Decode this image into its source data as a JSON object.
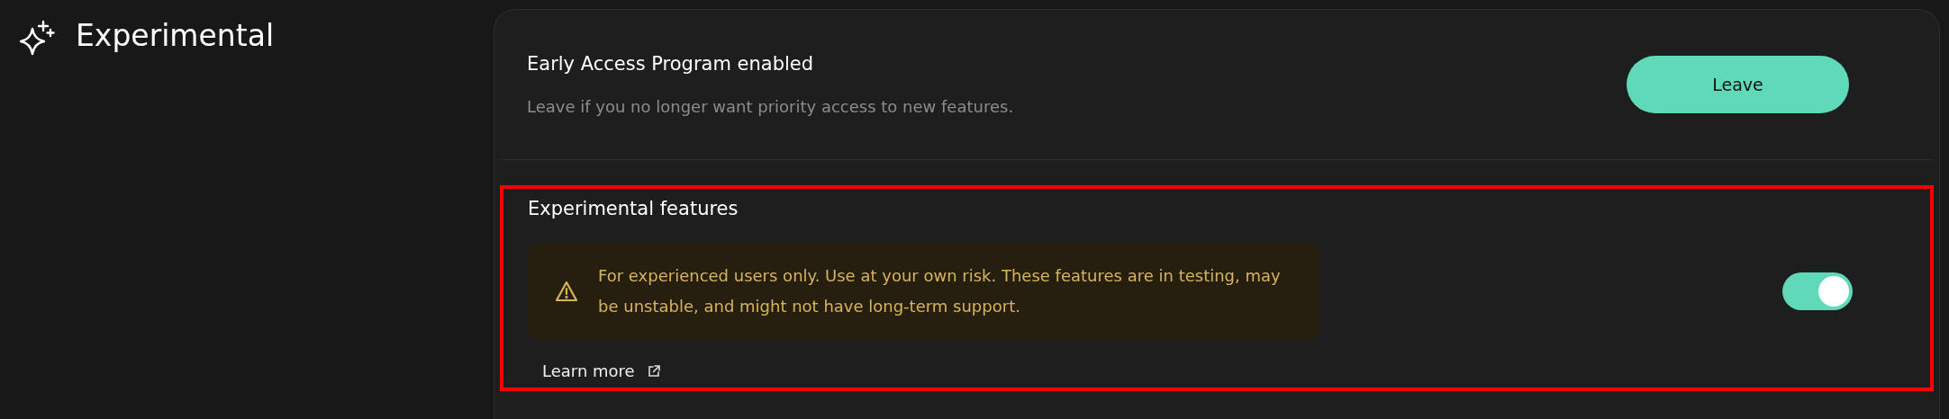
{
  "page": {
    "title": "Experimental"
  },
  "early_access": {
    "title": "Early Access Program enabled",
    "description": "Leave if you no longer want priority access to new features.",
    "button": "Leave"
  },
  "experimental_features": {
    "title": "Experimental features",
    "highlighted": true,
    "warning": "For experienced users only. Use at your own risk. These features are in testing, may be unstable, and might not have long-term support.",
    "on": true,
    "link": "Learn more"
  }
}
